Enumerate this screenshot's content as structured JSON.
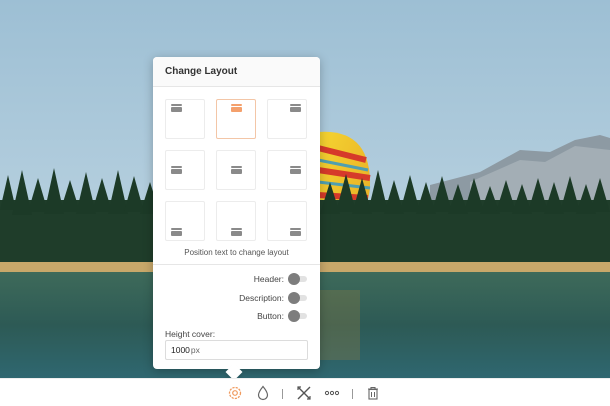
{
  "panel": {
    "title": "Change Layout",
    "grid_positions": [
      "top-left",
      "top-center",
      "top-right",
      "middle-left",
      "middle-center",
      "middle-right",
      "bottom-left",
      "bottom-center",
      "bottom-right"
    ],
    "active_position": "top-center",
    "hint": "Position text to change layout",
    "toggles": {
      "header": {
        "label": "Header:",
        "on": false
      },
      "description": {
        "label": "Description:",
        "on": false
      },
      "button": {
        "label": "Button:",
        "on": false
      }
    },
    "height": {
      "label": "Height cover:",
      "value": "1000",
      "unit": "px"
    }
  },
  "toolbar": {
    "items": [
      "settings-icon",
      "color-drop-icon",
      "crop-tools-icon",
      "more-icon",
      "delete-icon"
    ],
    "active_item": "settings-icon"
  },
  "colors": {
    "accent": "#f4a06c",
    "active_icon": "#f09a5e",
    "panel_bg": "#ffffff"
  }
}
